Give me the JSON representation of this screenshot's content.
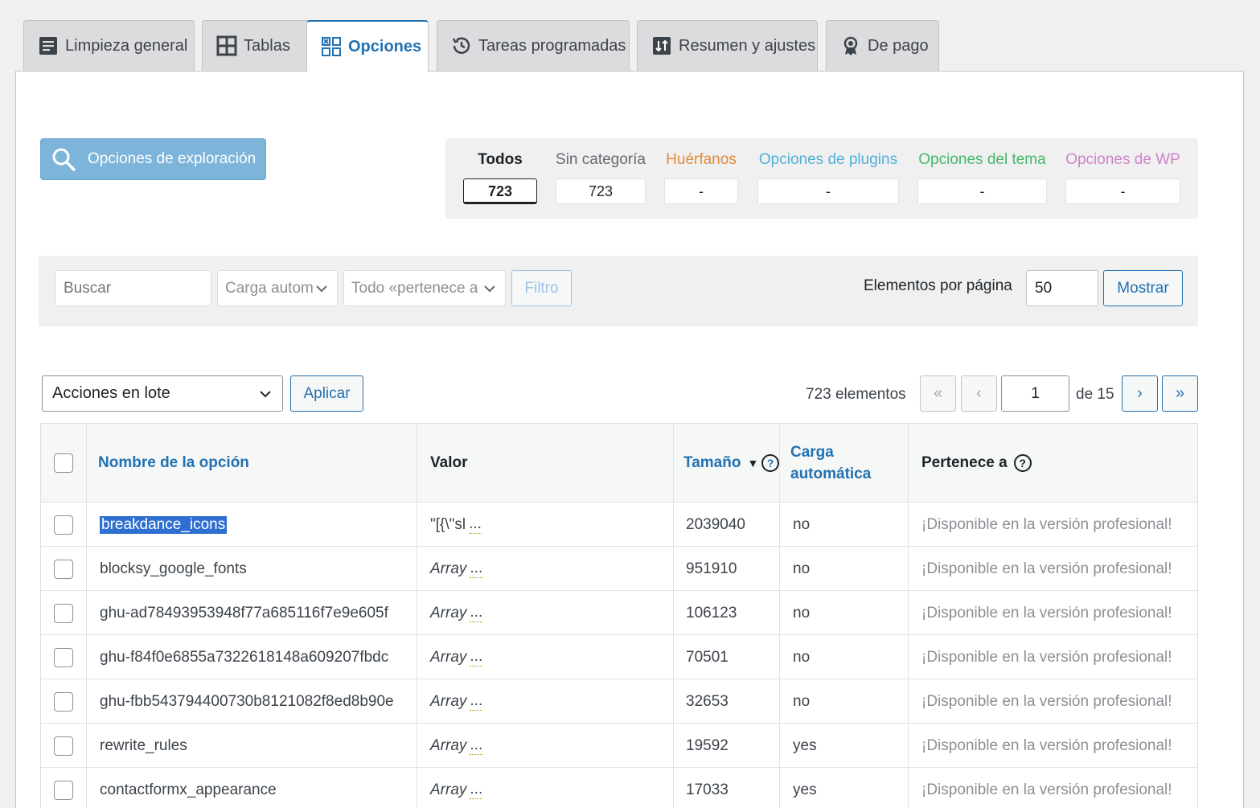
{
  "tabs": [
    {
      "label": "Limpieza general",
      "icon": "document-list-icon"
    },
    {
      "label": "Tablas",
      "icon": "table-grid-icon"
    },
    {
      "label": "Opciones",
      "icon": "options-grid-icon"
    },
    {
      "label": "Tareas programadas",
      "icon": "history-clock-icon"
    },
    {
      "label": "Resumen y ajustes",
      "icon": "sort-arrows-icon"
    },
    {
      "label": "De pago",
      "icon": "award-ribbon-icon"
    }
  ],
  "scan_button": "Opciones de exploración",
  "filters": [
    {
      "label": "Todos",
      "count": "723",
      "color": "#1d2327"
    },
    {
      "label": "Sin categoría",
      "count": "723",
      "color": "#646970"
    },
    {
      "label": "Huérfanos",
      "count": "-",
      "color": "#e08a3c"
    },
    {
      "label": "Opciones de plugins",
      "count": "-",
      "color": "#4fb0d8"
    },
    {
      "label": "Opciones del tema",
      "count": "-",
      "color": "#45b86b"
    },
    {
      "label": "Opciones de WP",
      "count": "-",
      "color": "#cf83c9"
    }
  ],
  "toolbar": {
    "search_placeholder": "Buscar",
    "autoload_select": "Carga autom",
    "belongs_select": "Todo «pertenece a»",
    "filter_button": "Filtro",
    "per_page_label": "Elementos por página",
    "per_page_value": "50",
    "show_button": "Mostrar"
  },
  "bulk": {
    "select": "Acciones en lote",
    "apply_button": "Aplicar"
  },
  "pagination": {
    "count_label": "723 elementos",
    "first": "«",
    "prev": "‹",
    "current": "1",
    "of_label": "de 15",
    "next": "›",
    "last": "»"
  },
  "table": {
    "headers": {
      "name": "Nombre de la opción",
      "value": "Valor",
      "size": "Tamaño",
      "sort_arrow": "▼",
      "help": "?",
      "autoload_line1": "Carga",
      "autoload_line2": "automática",
      "belongs": "Pertenece a"
    },
    "rows": [
      {
        "name": "breakdance_icons",
        "value": "\"[{\\\"sl",
        "value_italic": false,
        "ellipsis": "...",
        "size": "2039040",
        "autoload": "no",
        "belongs": "¡Disponible en la versión profesional!"
      },
      {
        "name": "blocksy_google_fonts",
        "value": "Array",
        "value_italic": true,
        "ellipsis": "...",
        "size": "951910",
        "autoload": "no",
        "belongs": "¡Disponible en la versión profesional!"
      },
      {
        "name": "ghu-ad78493953948f77a685116f7e9e605f",
        "value": "Array",
        "value_italic": true,
        "ellipsis": "...",
        "size": "106123",
        "autoload": "no",
        "belongs": "¡Disponible en la versión profesional!"
      },
      {
        "name": "ghu-f84f0e6855a7322618148a609207fbdc",
        "value": "Array",
        "value_italic": true,
        "ellipsis": "...",
        "size": "70501",
        "autoload": "no",
        "belongs": "¡Disponible en la versión profesional!"
      },
      {
        "name": "ghu-fbb543794400730b8121082f8ed8b90e",
        "value": "Array",
        "value_italic": true,
        "ellipsis": "...",
        "size": "32653",
        "autoload": "no",
        "belongs": "¡Disponible en la versión profesional!"
      },
      {
        "name": "rewrite_rules",
        "value": "Array",
        "value_italic": true,
        "ellipsis": "...",
        "size": "19592",
        "autoload": "yes",
        "belongs": "¡Disponible en la versión profesional!"
      },
      {
        "name": "contactformx_appearance",
        "value": "Array",
        "value_italic": true,
        "ellipsis": "...",
        "size": "17033",
        "autoload": "yes",
        "belongs": "¡Disponible en la versión profesional!"
      }
    ]
  }
}
